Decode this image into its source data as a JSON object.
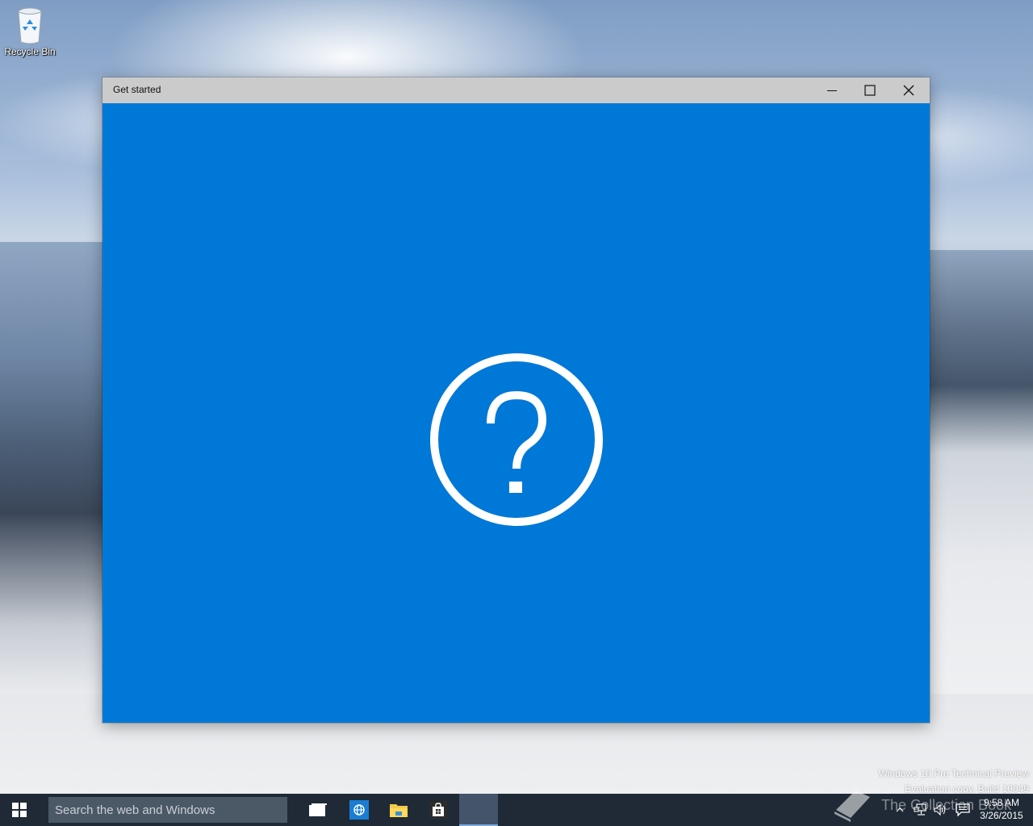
{
  "desktop": {
    "icons": [
      {
        "label": "Recycle Bin",
        "icon": "recycle-bin-icon"
      }
    ],
    "watermark": {
      "line1": "Windows 10 Pro Technical Preview",
      "line2": "Evaluation copy. Build 10049"
    },
    "overlay_brand": "The Collection Book"
  },
  "window": {
    "title": "Get started",
    "accent_color": "#0078d7",
    "controls": [
      "minimize-icon",
      "maximize-icon",
      "close-icon"
    ],
    "content_icon": "help-question-icon"
  },
  "taskbar": {
    "search": {
      "placeholder": "Search the web and Windows",
      "value": ""
    },
    "pinned": [
      {
        "name": "Task View",
        "icon": "task-view-icon"
      },
      {
        "name": "Internet Explorer",
        "icon": "ie-icon"
      },
      {
        "name": "File Explorer",
        "icon": "folder-icon"
      },
      {
        "name": "Store",
        "icon": "store-icon"
      },
      {
        "name": "Get started",
        "icon": "get-started-icon",
        "active": true
      }
    ],
    "tray": {
      "icons": [
        "chevron-up-icon",
        "network-icon",
        "volume-icon",
        "action-center-icon"
      ]
    },
    "clock": {
      "time": "9:58 AM",
      "date": "3/26/2015"
    }
  }
}
